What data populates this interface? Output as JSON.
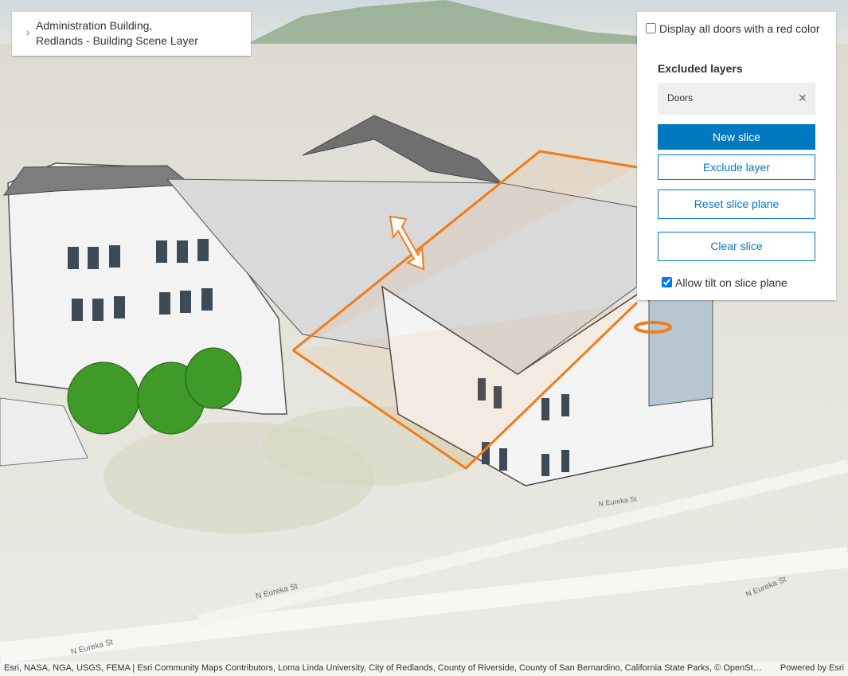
{
  "layer_list": {
    "chevron_icon": "chevron-right-icon",
    "title_line1": "Administration Building,",
    "title_line2": "Redlands - Building Scene Layer"
  },
  "slice_panel": {
    "display_doors_label": "Display all doors with a red color",
    "display_doors_checked": false,
    "excluded_layers_title": "Excluded layers",
    "excluded_items": [
      {
        "label": "Doors",
        "remove_icon": "close-icon"
      }
    ],
    "new_slice_label": "New slice",
    "exclude_layer_label": "Exclude layer",
    "reset_slice_label": "Reset slice plane",
    "clear_slice_label": "Clear slice",
    "allow_tilt_label": "Allow tilt on slice plane",
    "allow_tilt_checked": true
  },
  "map": {
    "street_labels": [
      "N Eureka St",
      "N Eureka St",
      "N Eureka St",
      "N Eureka St"
    ]
  },
  "attribution": {
    "sources": "Esri, NASA, NGA, USGS, FEMA | Esri Community Maps Contributors, Loma Linda University, City of Redlands, County of Riverside, County of San Bernardino, California State Parks, © OpenStreetMap, Microsoft, Esri, TomTom, Garmin, SafeGraph, GeoTechnologies, Inc, METI/NASA, USGS, Bureau of Land Management, EPA, NPS, US Census Bureau, USDA, USFWS",
    "powered_by": "Powered by Esri"
  },
  "colors": {
    "accent": "#0079c1",
    "slice_plane": "#f07d1a"
  }
}
